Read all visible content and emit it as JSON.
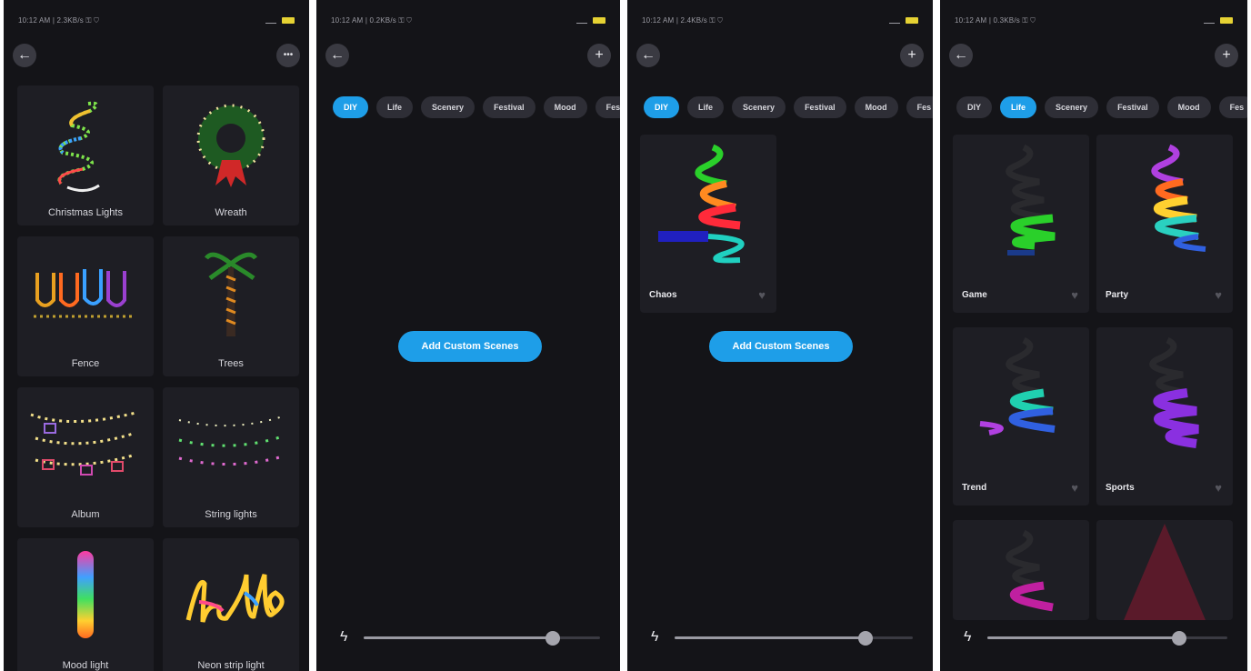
{
  "status": {
    "p1_time": "10:12 AM | 2.3KB/s ⚿ ⛉",
    "p2_time": "10:12 AM | 0.2KB/s ⚿ ⛉",
    "p3_time": "10:12 AM | 2.4KB/s ⚿ ⛉",
    "p4_time": "10:12 AM | 0.3KB/s ⚿ ⛉"
  },
  "effects_panel": {
    "back_icon": "arrow-left-icon",
    "more_label": "•••",
    "cards": [
      {
        "label": "Christmas Lights"
      },
      {
        "label": "Wreath"
      },
      {
        "label": "Fence"
      },
      {
        "label": "Trees"
      },
      {
        "label": "Album"
      },
      {
        "label": "String lights"
      },
      {
        "label": "Mood light"
      },
      {
        "label": "Neon strip light"
      }
    ]
  },
  "scene_tabs": [
    "DIY",
    "Life",
    "Scenery",
    "Festival",
    "Mood",
    "Fes"
  ],
  "diy_panel_empty": {
    "active_tab": "DIY",
    "add_button_label": "Add Custom Scenes",
    "slider_value": 0.8
  },
  "diy_panel_with_scene": {
    "active_tab": "DIY",
    "scene_name": "Chaos",
    "add_button_label": "Add Custom Scenes",
    "slider_value": 0.8
  },
  "life_panel": {
    "active_tab": "Life",
    "scenes": [
      {
        "name": "Game"
      },
      {
        "name": "Party"
      },
      {
        "name": "Trend"
      },
      {
        "name": "Sports"
      }
    ],
    "slider_value": 0.8
  },
  "colors": {
    "accent": "#1e9ee8",
    "background": "#141418",
    "card": "#1e1e24"
  }
}
